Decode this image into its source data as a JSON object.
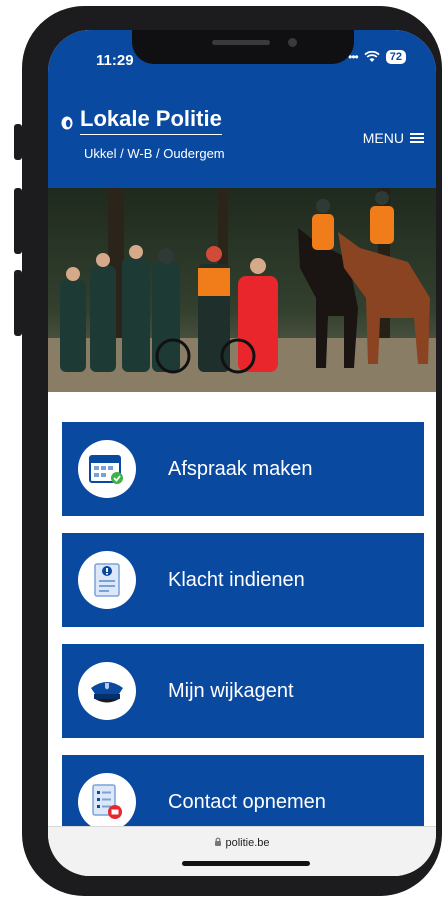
{
  "status_bar": {
    "time": "11:29",
    "battery": "72"
  },
  "header": {
    "logo_title": "Lokale Politie",
    "subtitle": "Ukkel / W-B / Oudergem",
    "menu_label": "MENU"
  },
  "tiles": [
    {
      "label": "Afspraak maken",
      "icon": "calendar-check-icon"
    },
    {
      "label": "Klacht indienen",
      "icon": "complaint-document-icon"
    },
    {
      "label": "Mijn wijkagent",
      "icon": "police-cap-icon"
    },
    {
      "label": "Contact opnemen",
      "icon": "contact-list-icon"
    }
  ],
  "browser": {
    "url": "politie.be"
  },
  "colors": {
    "brand": "#0a49a0",
    "accent_orange": "#f07d1a",
    "accent_red": "#e8262c"
  }
}
